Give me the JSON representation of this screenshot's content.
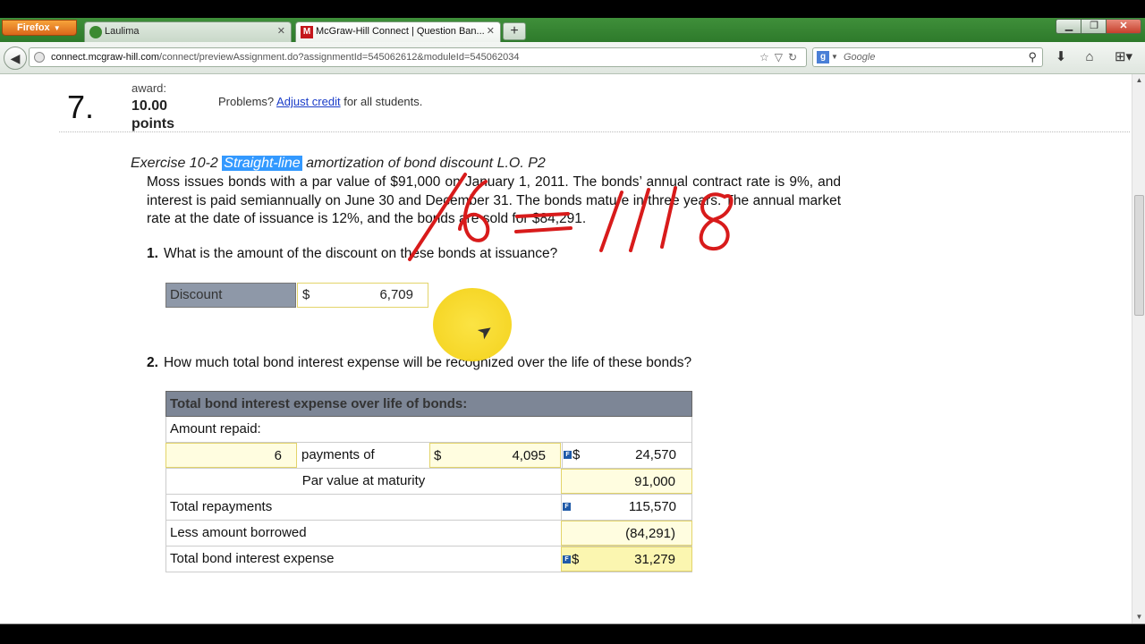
{
  "browser": {
    "app_button": "Firefox",
    "tabs": [
      {
        "title": "Laulima"
      },
      {
        "title": "McGraw-Hill Connect | Question Ban..."
      }
    ],
    "url_domain": "connect.mcgraw-hill.com",
    "url_path": "/connect/previewAssignment.do?assignmentId=545062612&moduleId=545062034",
    "search_placeholder": "Google"
  },
  "question": {
    "number": "7.",
    "award_label": "award:",
    "points": "10.00 points",
    "problems_prefix": "Problems?",
    "adjust_credit_link": "Adjust credit",
    "problems_suffix": "for all students."
  },
  "exercise": {
    "title_prefix": "Exercise 10-2",
    "title_highlight": "Straight-line",
    "title_suffix": "amortization of bond discount L.O. P2",
    "body": "Moss issues bonds with a par value of $91,000 on January 1, 2011. The bonds’ annual contract rate is 9%, and interest is paid semiannually on June 30 and December 31. The bonds mature in three years. The annual market rate at the date of issuance is 12%, and the bonds are sold for $84,291."
  },
  "q1": {
    "number": "1.",
    "text": "What is the amount of the discount on these bonds at issuance?",
    "label": "Discount",
    "currency": "$",
    "value": "6,709"
  },
  "q2": {
    "number": "2.",
    "text": "How much total bond interest expense will be recognized over the life of these bonds?",
    "table_header": "Total bond interest expense over life of bonds:",
    "amount_repaid_label": "Amount repaid:",
    "payments_count": "6",
    "payments_of_label": "payments of",
    "payment_currency": "$",
    "payment_amount": "4,095",
    "payments_total_currency": "$",
    "payments_total": "24,570",
    "par_label": "Par value at maturity",
    "par_value": "91,000",
    "total_repayments_label": "Total repayments",
    "total_repayments": "115,570",
    "less_borrowed_label": "Less amount borrowed",
    "less_borrowed": "(84,291)",
    "total_expense_label": "Total bond interest expense",
    "total_expense_currency": "$",
    "total_expense": "31,279",
    "f_icon": "F"
  },
  "annotation": {
    "handwritten": "/6 = 1118"
  },
  "colors": {
    "highlight": "#3399ff",
    "header_gray": "#7d8696",
    "input_border": "#e3d46a",
    "ink_red": "#d81b1b",
    "cursor_highlight": "#f3cf10"
  }
}
